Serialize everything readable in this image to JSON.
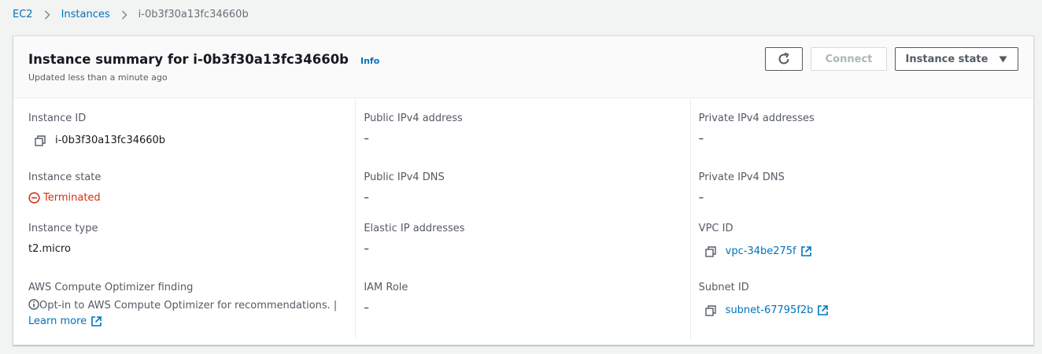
{
  "breadcrumb": {
    "items": [
      "EC2",
      "Instances",
      "i-0b3f30a13fc34660b"
    ]
  },
  "header": {
    "title": "Instance summary for i-0b3f30a13fc34660b",
    "info": "Info",
    "subtitle": "Updated less than a minute ago",
    "connect_label": "Connect",
    "state_label": "Instance state"
  },
  "fields": {
    "instance_id": {
      "label": "Instance ID",
      "value": "i-0b3f30a13fc34660b"
    },
    "instance_state": {
      "label": "Instance state",
      "value": "Terminated"
    },
    "instance_type": {
      "label": "Instance type",
      "value": "t2.micro"
    },
    "optimizer": {
      "label": "AWS Compute Optimizer finding",
      "text": "Opt-in to AWS Compute Optimizer for recommendations. |",
      "link": "Learn more"
    },
    "public_ipv4": {
      "label": "Public IPv4 address",
      "value": "–"
    },
    "public_dns": {
      "label": "Public IPv4 DNS",
      "value": "–"
    },
    "elastic_ip": {
      "label": "Elastic IP addresses",
      "value": "–"
    },
    "iam_role": {
      "label": "IAM Role",
      "value": "–"
    },
    "private_ipv4": {
      "label": "Private IPv4 addresses",
      "value": "–"
    },
    "private_dns": {
      "label": "Private IPv4 DNS",
      "value": "–"
    },
    "vpc_id": {
      "label": "VPC ID",
      "value": "vpc-34be275f"
    },
    "subnet_id": {
      "label": "Subnet ID",
      "value": "subnet-67795f2b"
    }
  },
  "colors": {
    "link": "#0073bb",
    "terminated": "#d13212"
  }
}
